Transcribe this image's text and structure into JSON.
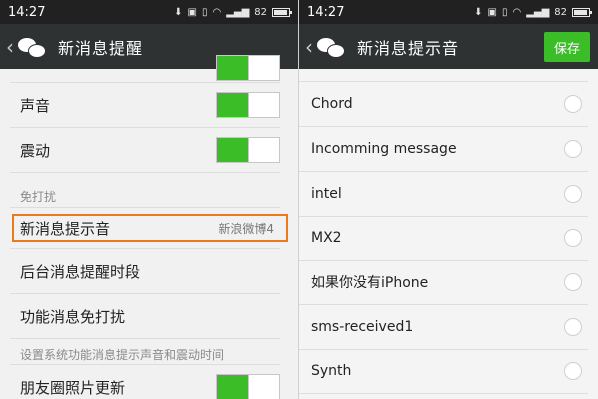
{
  "left": {
    "status": {
      "time": "14:27",
      "battery": "82"
    },
    "header": {
      "back": "‹",
      "title": "新消息提醒"
    },
    "rows": [
      {
        "label": "声音"
      },
      {
        "label": "震动"
      }
    ],
    "section_dnd": "免打扰",
    "highlight_row": {
      "label": "新消息提示音",
      "value": "新浪微博4"
    },
    "row_background": {
      "label": "后台消息提醒时段"
    },
    "row_feature": {
      "label": "功能消息免打扰"
    },
    "hint": "设置系统功能消息提示声音和震动时间",
    "row_moments": {
      "label": "朋友圈照片更新"
    }
  },
  "right": {
    "status": {
      "time": "14:27",
      "battery": "82"
    },
    "header": {
      "back": "‹",
      "title": "新消息提示音",
      "save_label": "保存"
    },
    "sounds": [
      "Chord",
      "Incomming message",
      "intel",
      "MX2",
      "如果你没有iPhone",
      "sms-received1",
      "Synth"
    ]
  }
}
